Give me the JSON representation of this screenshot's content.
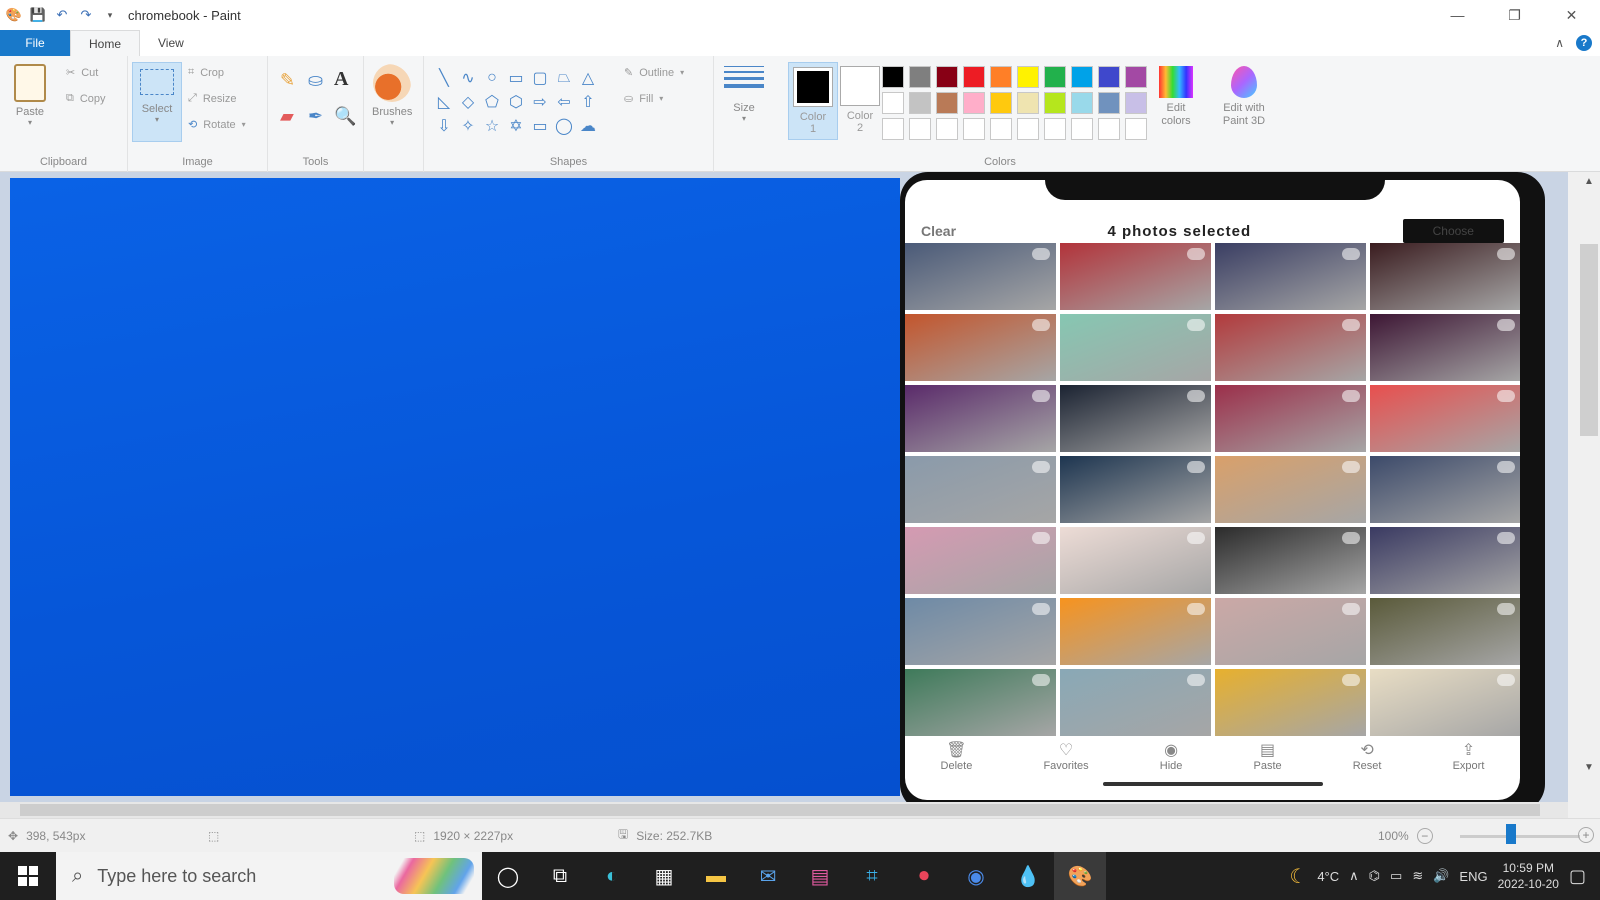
{
  "titlebar": {
    "title": "chromebook - Paint",
    "quick_access": [
      "save-icon",
      "undo-icon",
      "redo-icon"
    ]
  },
  "tabs": {
    "file": "File",
    "home": "Home",
    "view": "View"
  },
  "ribbon": {
    "clipboard": {
      "label": "Clipboard",
      "paste": "Paste",
      "cut": "Cut",
      "copy": "Copy"
    },
    "image": {
      "label": "Image",
      "select": "Select",
      "crop": "Crop",
      "resize": "Resize",
      "rotate": "Rotate"
    },
    "tools": {
      "label": "Tools"
    },
    "brushes": {
      "label": "Brushes"
    },
    "shapes": {
      "label": "Shapes",
      "outline": "Outline",
      "fill": "Fill"
    },
    "size": {
      "label": "Size"
    },
    "colors": {
      "label": "Colors",
      "color1": "Color 1",
      "color2": "Color 2",
      "color1_value": "#000000",
      "color2_value": "#ffffff",
      "edit_colors": "Edit colors",
      "edit_with_paint3d": "Edit with Paint 3D",
      "palette_row1": [
        "#000000",
        "#7f7f7f",
        "#880015",
        "#ed1c24",
        "#ff7f27",
        "#fff200",
        "#22b14c",
        "#00a2e8",
        "#3f48cc",
        "#a349a4"
      ],
      "palette_row2": [
        "#ffffff",
        "#c3c3c3",
        "#b97a57",
        "#ffaec9",
        "#ffc90e",
        "#efe4b0",
        "#b5e61d",
        "#99d9ea",
        "#7092be",
        "#c8bfe7"
      ],
      "palette_row3": [
        "#ffffff",
        "#ffffff",
        "#ffffff",
        "#ffffff",
        "#ffffff",
        "#ffffff",
        "#ffffff",
        "#ffffff",
        "#ffffff",
        "#ffffff"
      ]
    }
  },
  "canvas": {
    "phone": {
      "clear": "Clear",
      "title": "4 photos selected",
      "choose": "Choose",
      "toolbar": [
        {
          "icon": "trash-icon",
          "label": "Delete"
        },
        {
          "icon": "heart-icon",
          "label": "Favorites"
        },
        {
          "icon": "eye-icon",
          "label": "Hide"
        },
        {
          "icon": "folder-icon",
          "label": "Paste"
        },
        {
          "icon": "reset-icon",
          "label": "Reset"
        },
        {
          "icon": "export-icon",
          "label": "Export"
        }
      ],
      "photos": [
        "#4a5a78",
        "#b2333a",
        "#3a3e63",
        "#3a1c1f",
        "#c3552c",
        "#86c7b2",
        "#b23a3c",
        "#3d1634",
        "#5a2a6a",
        "#1b2332",
        "#9b2f4a",
        "#e84f4e",
        "#8a9aaa",
        "#1d3550",
        "#d9a06a",
        "#3c4a6a",
        "#d59ab2",
        "#eddcd6",
        "#2b2b2b",
        "#3a3a62",
        "#6e8aa6",
        "#f7931e",
        "#cba8a6",
        "#5a5a3a",
        "#3e7a5a",
        "#89a8b6",
        "#e7b02e",
        "#e8ddc4"
      ]
    }
  },
  "statusbar": {
    "cursor_pos": "398, 543px",
    "dimensions": "1920 × 2227px",
    "size": "Size: 252.7KB",
    "zoom": "100%"
  },
  "taskbar": {
    "search_placeholder": "Type here to search",
    "weather": "4°C",
    "language": "ENG",
    "time": "10:59 PM",
    "date": "2022-10-20"
  }
}
